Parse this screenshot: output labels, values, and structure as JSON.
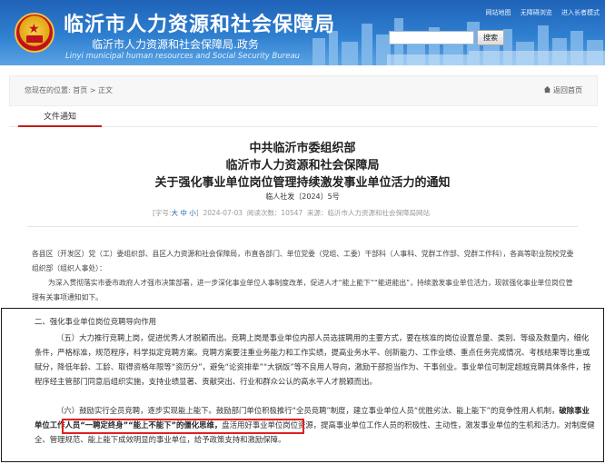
{
  "header": {
    "title": "临沂市人力资源和社会保障局",
    "subtitle": "临沂市人力资源和社会保障局.政务",
    "english": "Linyi municipal human resources and Social Security Bureau",
    "toplinks": [
      "网站地图",
      "无障碍浏览",
      "进入长者模式"
    ],
    "search_placeholder": "",
    "search_button": "搜索",
    "brand_color": "#2f7fd0"
  },
  "breadcrumb": {
    "prefix": "您现在的位置:",
    "home": "首页",
    "sep": ">",
    "current": "正文",
    "back_label": "返回首页"
  },
  "tab": {
    "label": "文件通知"
  },
  "article": {
    "org1": "中共临沂市委组织部",
    "org2": "临沂市人力资源和社会保障局",
    "title": "关于强化事业单位岗位管理持续激发事业单位活力的通知",
    "doc_number": "临人社发〔2024〕5号",
    "meta": {
      "font_label": "[字号:",
      "font_big": "大",
      "font_mid": "中",
      "font_small": "小",
      "font_end": "]",
      "date": "2024-07-03",
      "views": "阅读次数：10547",
      "source": "来源：临沂市人力资源和社会保障局网站"
    },
    "recipient": "各县区（开发区）党（工）委组织部、县区人力资源和社会保障局，市直各部门、单位党委（党组、工委）干部科（人事科、党群工作部、党群工作科），各高等职业院校党委组织部（组织人事处）：",
    "intro": "为深入贯彻落实市委市政府人才强市决策部署，进一步深化事业单位人事制度改革，促进人才“能上能下”“能进能出”，持续激发事业单位活力，现就强化事业单位岗位管理有关事项通知如下。"
  },
  "zoom": {
    "heading": "二、强化事业单位岗位竞聘导向作用",
    "p5": "（五）大力推行竞聘上岗，促进优秀人才脱颖而出。竞聘上岗是事业单位内部人员选拔聘用的主要方式，要在核准的岗位设置总量、类别、等级及数量内，细化条件，严格标准，规范程序，科学拟定竞聘方案。竞聘方案要注重业务能力和工作实绩，提高业务水平、创新能力、工作业绩、重点任务完成情况、考核结果等比重或赋分，降低年龄、工龄、取得资格年限等“资历分”，避免“论资排辈”“大锅饭”等不良用人导向，激励干部担当作为、干事创业。事业单位可制定超越竞聘具体条件，按程序经主管部门同意后组织实施，支持业绩显著、贡献突出、行业和群众公认的高水平人才脱颖而出。",
    "p6_a": "（六）鼓励实行全员竞聘，逐步实现能上能下。鼓励部门单位积极推行“全员竞聘”制度，建立事业单位人员“优胜劣汰、能上能下”的竞争性用人机制，",
    "p6_highlight": "破除事业单位工作人员“一聘定终身”“能上不能下”的僵化思维，",
    "p6_b": "盘活用好事业单位岗位资源，提高事业单位工作人员的积极性、主动性，激发事业单位的生机和活力。对制度健全、管理规范、能上能下成效明显的事业单位，给予政策支持和激励保障。",
    "highlight_color": "#e02020"
  }
}
